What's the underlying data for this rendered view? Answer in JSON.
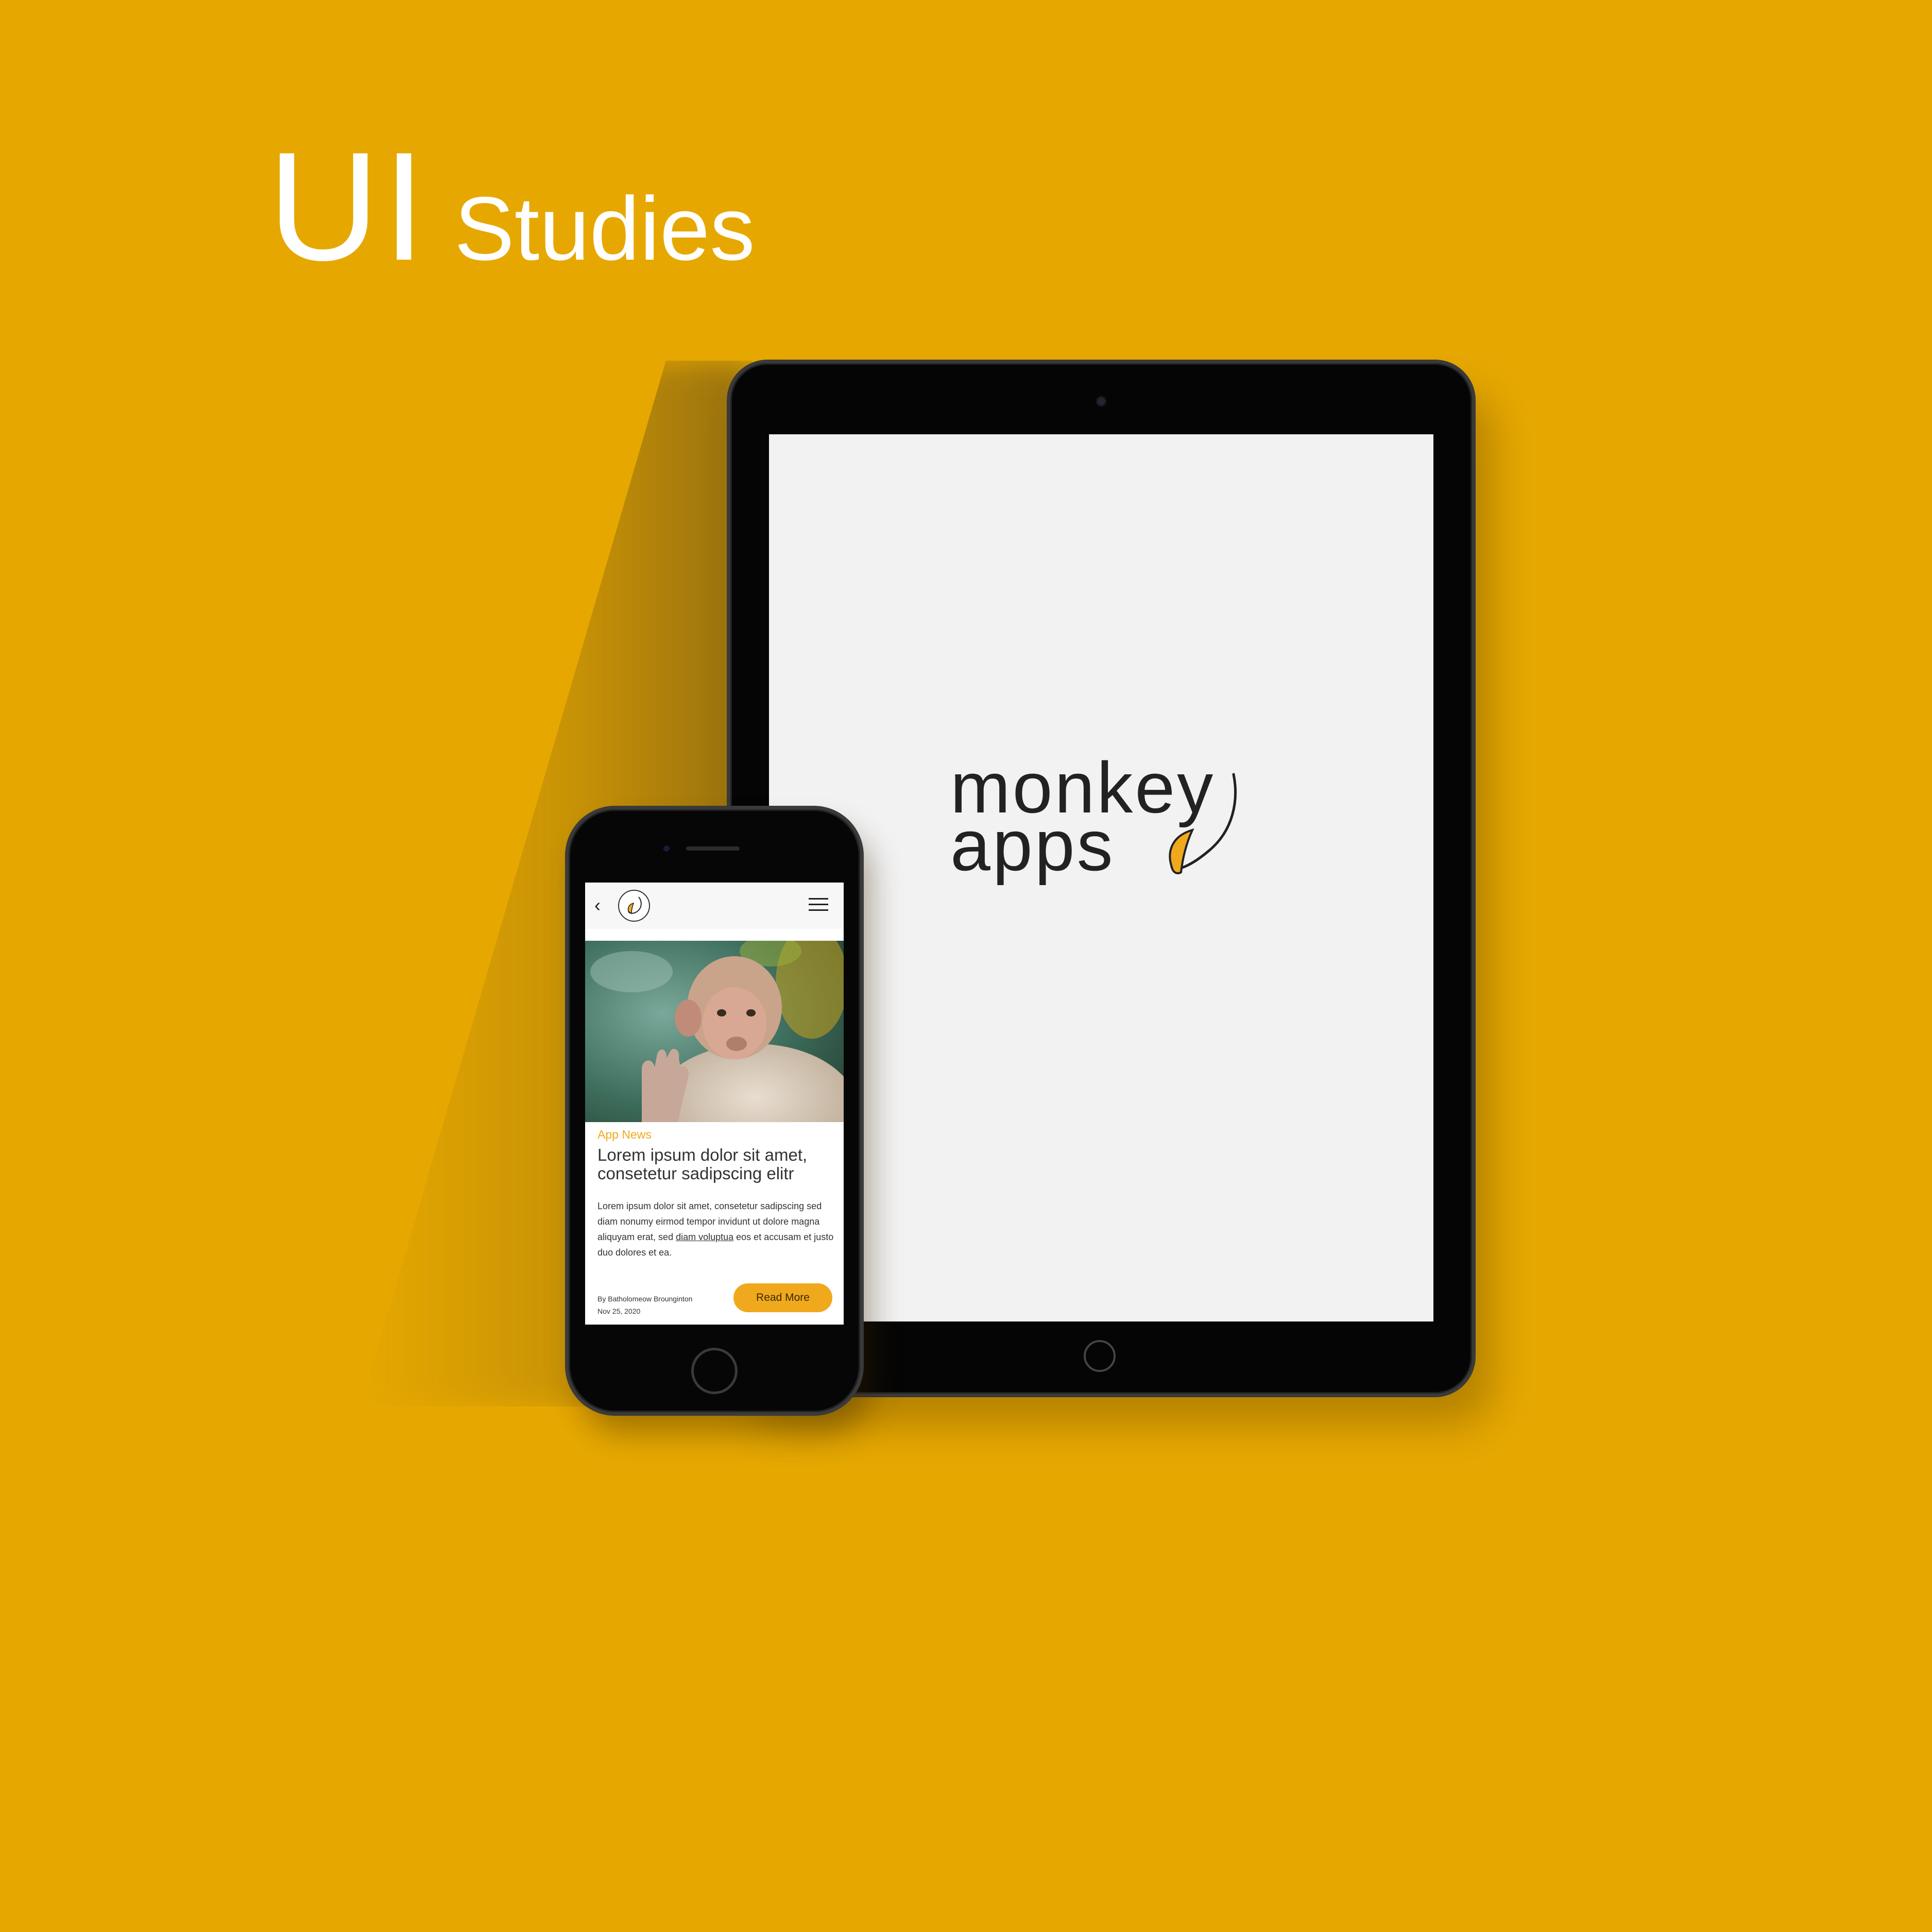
{
  "heading": {
    "big": "UI",
    "small": "Studies"
  },
  "tablet": {
    "logo": {
      "line1": "monkey",
      "line2": "apps"
    }
  },
  "phone": {
    "article": {
      "category": "App News",
      "title": "Lorem ipsum dolor sit amet, consetetur sadipscing elitr",
      "body_part1": "Lorem ipsum dolor sit amet, consetetur sadipscing sed diam nonumy eirmod tempor invidunt ut dolore magna aliquyam erat, sed ",
      "body_link": "diam voluptua",
      "body_part2": " eos et accusam et justo duo dolores et ea.",
      "author": "By Batholomeow Brounginton",
      "date": "Nov 25, 2020",
      "read_more": "Read More"
    }
  },
  "colors": {
    "background": "#E6A800",
    "accent": "#F0A91D",
    "device": "#050505",
    "tablet_screen": "#F2F2F2"
  },
  "icons": {
    "back": "chevron-left-icon",
    "menu": "hamburger-menu-icon",
    "logo_mark": "banana-swirl-logo"
  }
}
